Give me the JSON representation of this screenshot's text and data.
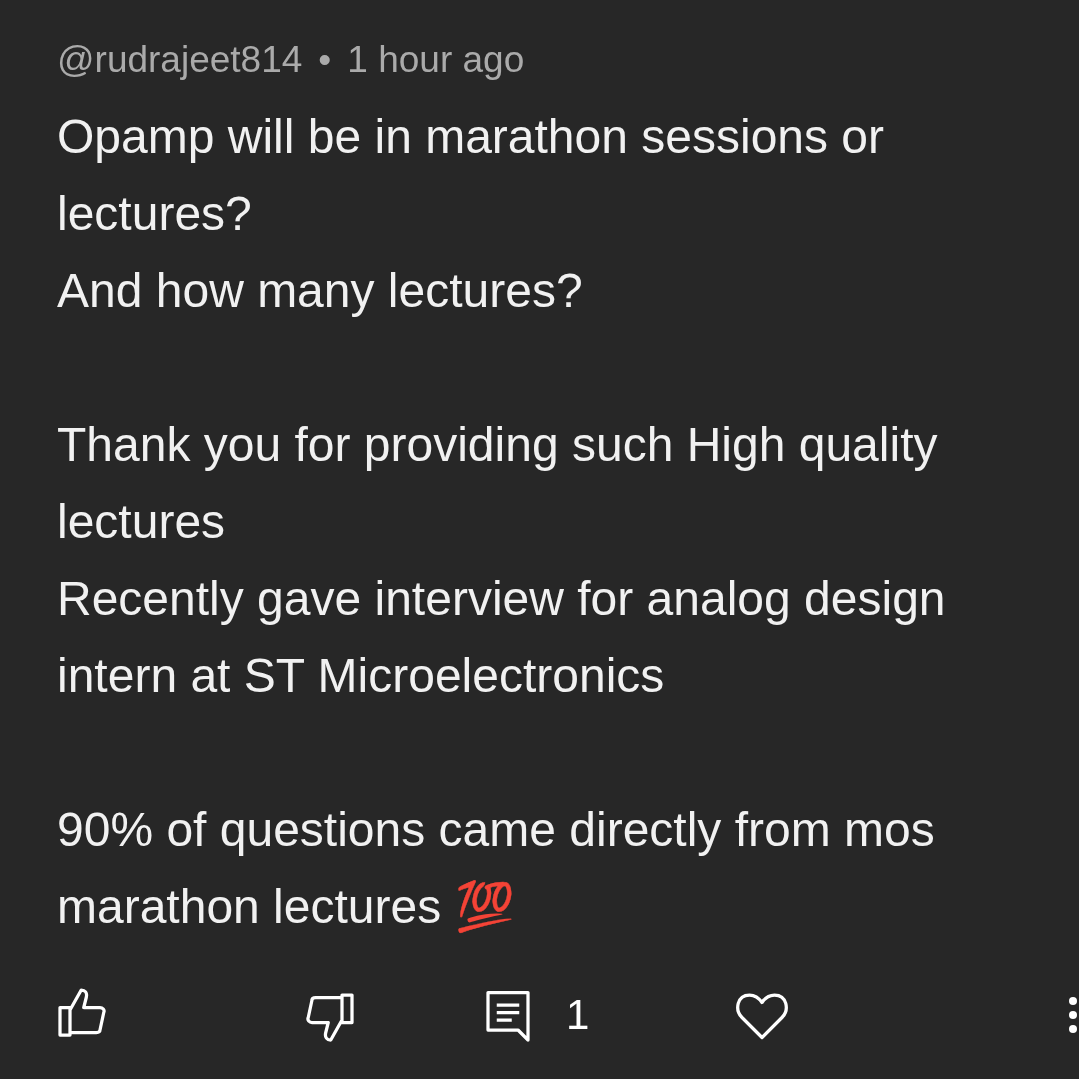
{
  "comment": {
    "author": "@rudrajeet814",
    "separator": "•",
    "time": "1 hour ago",
    "paragraphs": [
      [
        {
          "text": "Opamp will be in marathon sessions or lectures?"
        },
        {
          "text": "And how many lectures?"
        }
      ],
      [
        {
          "text": "Thank you for providing such High quality lectures"
        },
        {
          "text": "Recently gave interview for analog design intern at ST Microelectronics"
        }
      ],
      [
        {
          "text": "90% of questions came directly from mos marathon lectures 💯"
        }
      ]
    ],
    "actions": [
      {
        "kind": "like"
      },
      {
        "kind": "dislike"
      },
      {
        "kind": "replies",
        "count": "1"
      },
      {
        "kind": "heart"
      },
      {
        "kind": "more"
      }
    ]
  }
}
